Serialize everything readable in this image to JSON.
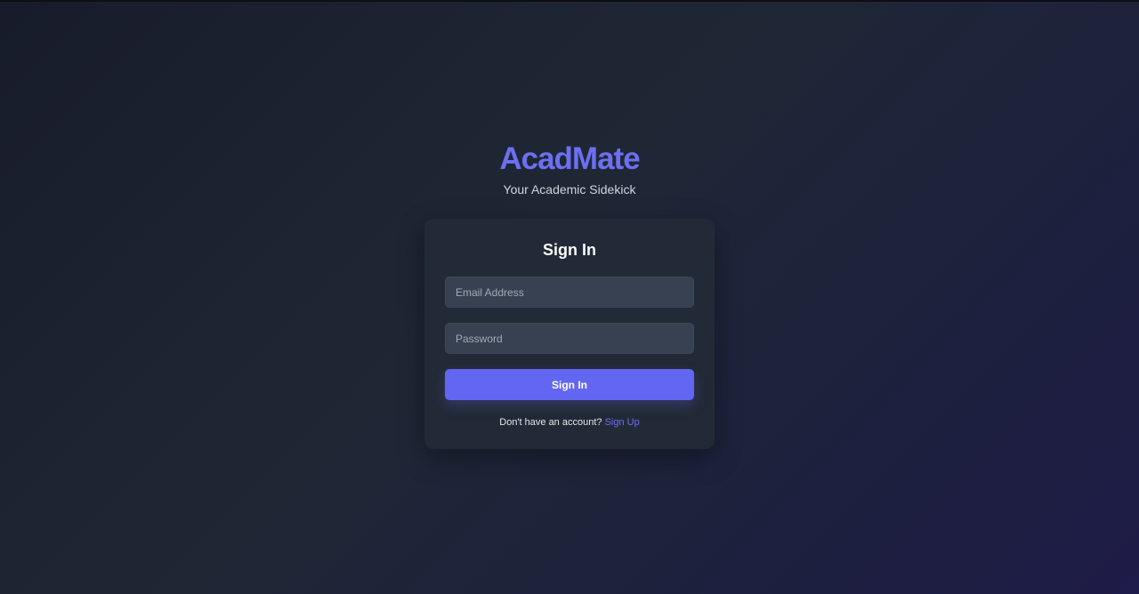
{
  "brand": {
    "name": "AcadMate",
    "tagline": "Your Academic Sidekick"
  },
  "signin": {
    "title": "Sign In",
    "email_placeholder": "Email Address",
    "password_placeholder": "Password",
    "submit_label": "Sign In",
    "footer_prompt": "Don't have an account?",
    "signup_link": "Sign Up"
  },
  "colors": {
    "accent": "#6366f1",
    "brand": "#6d6ff0",
    "card_bg": "#222a37",
    "input_bg": "#384152"
  }
}
